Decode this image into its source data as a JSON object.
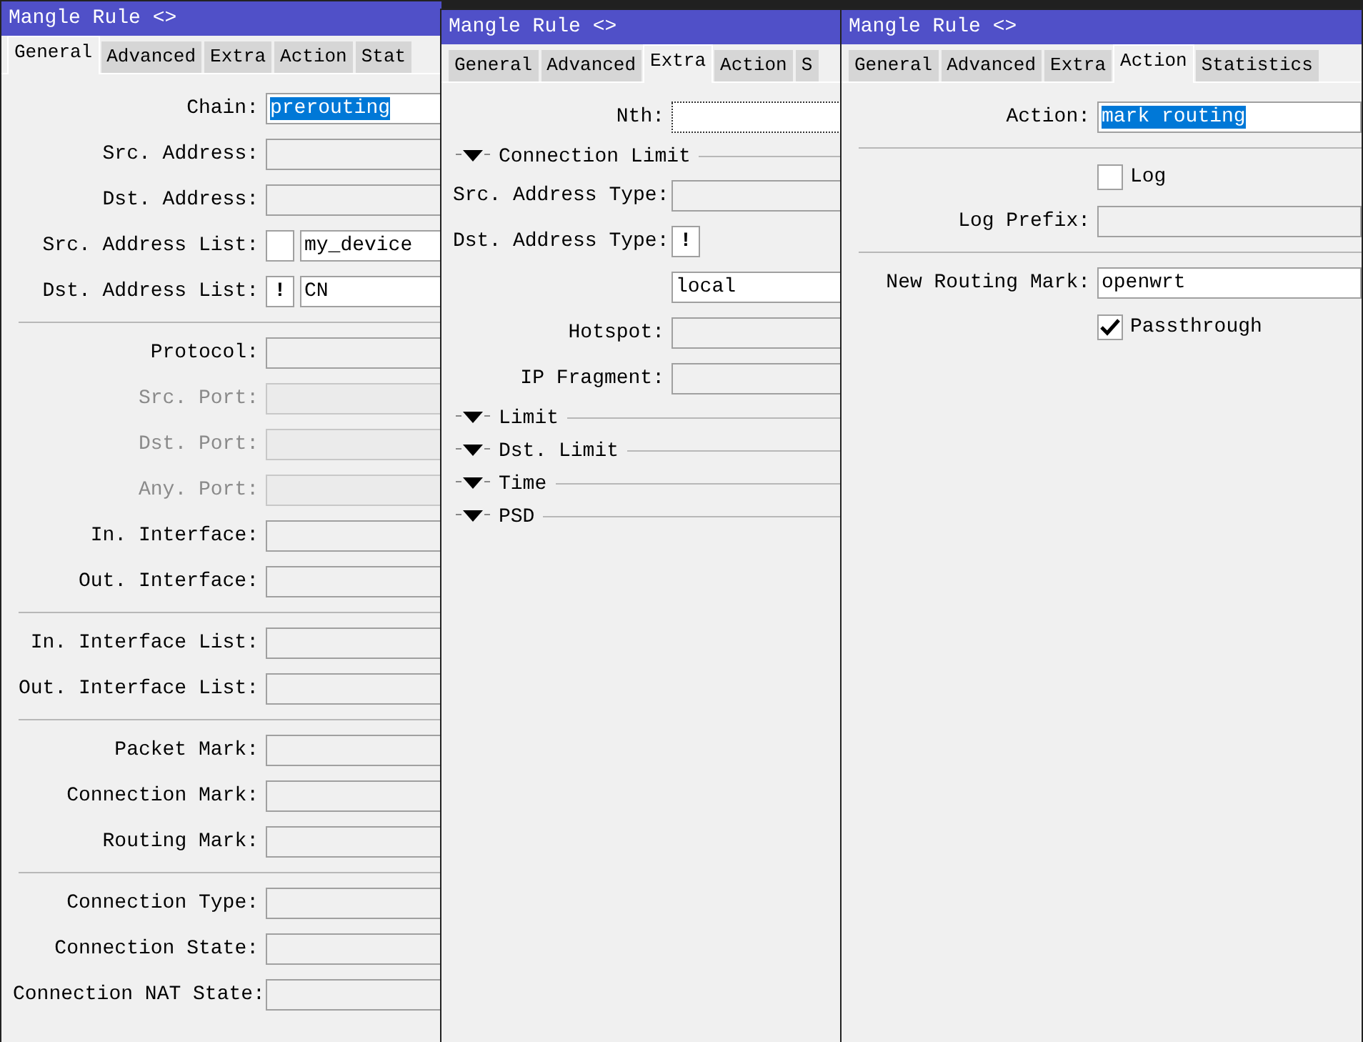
{
  "windows": [
    {
      "title": "Mangle Rule <>",
      "tabs": [
        {
          "label": "General",
          "selected": true
        },
        {
          "label": "Advanced",
          "selected": false
        },
        {
          "label": "Extra",
          "selected": false
        },
        {
          "label": "Action",
          "selected": false
        },
        {
          "label": "Stat",
          "selected": false
        }
      ],
      "rows": [
        {
          "kind": "field",
          "label": "Chain:",
          "value": "prerouting",
          "value_selected": true,
          "disabled": false,
          "focused": false
        },
        {
          "kind": "field",
          "label": "Src. Address:",
          "disabled": false,
          "focused": false
        },
        {
          "kind": "field",
          "label": "Dst. Address:",
          "disabled": false,
          "focused": false
        },
        {
          "kind": "list",
          "label": "Src. Address List:",
          "value": "my_device"
        },
        {
          "kind": "list",
          "label": "Dst. Address List:",
          "negate": "!",
          "value": "CN"
        },
        {
          "kind": "divider"
        },
        {
          "kind": "field",
          "label": "Protocol:",
          "disabled": false,
          "focused": false
        },
        {
          "kind": "field",
          "label": "Src. Port:",
          "disabled": true,
          "focused": false
        },
        {
          "kind": "field",
          "label": "Dst. Port:",
          "disabled": true,
          "focused": false
        },
        {
          "kind": "field",
          "label": "Any. Port:",
          "disabled": true,
          "focused": false
        },
        {
          "kind": "field",
          "label": "In. Interface:",
          "disabled": false,
          "focused": false
        },
        {
          "kind": "field",
          "label": "Out. Interface:",
          "disabled": false,
          "focused": false
        },
        {
          "kind": "divider"
        },
        {
          "kind": "field",
          "label": "In. Interface List:",
          "disabled": false,
          "focused": false
        },
        {
          "kind": "field",
          "label": "Out. Interface List:",
          "disabled": false,
          "focused": false
        },
        {
          "kind": "divider"
        },
        {
          "kind": "field",
          "label": "Packet Mark:",
          "disabled": false,
          "focused": false
        },
        {
          "kind": "field",
          "label": "Connection Mark:",
          "disabled": false,
          "focused": false
        },
        {
          "kind": "field",
          "label": "Routing Mark:",
          "disabled": false,
          "focused": false
        },
        {
          "kind": "divider"
        },
        {
          "kind": "field",
          "label": "Connection Type:",
          "disabled": false,
          "focused": false
        },
        {
          "kind": "field",
          "label": "Connection State:",
          "disabled": false,
          "focused": false
        },
        {
          "kind": "field",
          "label": "Connection NAT State:",
          "disabled": false,
          "focused": false
        }
      ]
    },
    {
      "title": "Mangle Rule <>",
      "tabs": [
        {
          "label": "General",
          "selected": false
        },
        {
          "label": "Advanced",
          "selected": false
        },
        {
          "label": "Extra",
          "selected": true
        },
        {
          "label": "Action",
          "selected": false
        },
        {
          "label": "S",
          "selected": false
        }
      ],
      "rows": [
        {
          "kind": "field",
          "label": "Nth:",
          "disabled": false,
          "focused": true
        },
        {
          "kind": "section",
          "label": "Connection Limit",
          "expanded": false
        },
        {
          "kind": "field",
          "label": "Src. Address Type:",
          "disabled": false,
          "focused": false
        },
        {
          "kind": "list",
          "label": "Dst. Address Type:",
          "negate": "!"
        },
        {
          "kind": "field",
          "value": "local",
          "value_selected": false,
          "disabled": false,
          "focused": false
        },
        {
          "kind": "field",
          "label": "Hotspot:",
          "disabled": false,
          "focused": false
        },
        {
          "kind": "field",
          "label": "IP Fragment:",
          "disabled": false,
          "focused": false
        },
        {
          "kind": "section",
          "label": "Limit",
          "expanded": false
        },
        {
          "kind": "section",
          "label": "Dst. Limit",
          "expanded": false
        },
        {
          "kind": "section",
          "label": "Time",
          "expanded": false
        },
        {
          "kind": "section",
          "label": "PSD",
          "expanded": false
        }
      ]
    },
    {
      "title": "Mangle Rule <>",
      "tabs": [
        {
          "label": "General",
          "selected": false
        },
        {
          "label": "Advanced",
          "selected": false
        },
        {
          "label": "Extra",
          "selected": false
        },
        {
          "label": "Action",
          "selected": true
        },
        {
          "label": "Statistics",
          "selected": false
        }
      ],
      "rows": [
        {
          "kind": "field",
          "label": "Action:",
          "value": "mark routing",
          "value_selected": true,
          "disabled": false,
          "focused": false
        },
        {
          "kind": "divider"
        },
        {
          "kind": "checkbox",
          "label": "Log",
          "checked": false
        },
        {
          "kind": "field",
          "label": "Log Prefix:",
          "disabled": false,
          "focused": false
        },
        {
          "kind": "divider"
        },
        {
          "kind": "field",
          "label": "New Routing Mark:",
          "value": "openwrt",
          "value_selected": false,
          "disabled": false,
          "focused": false
        },
        {
          "kind": "checkbox",
          "label": "Passthrough",
          "checked": true
        }
      ]
    }
  ]
}
